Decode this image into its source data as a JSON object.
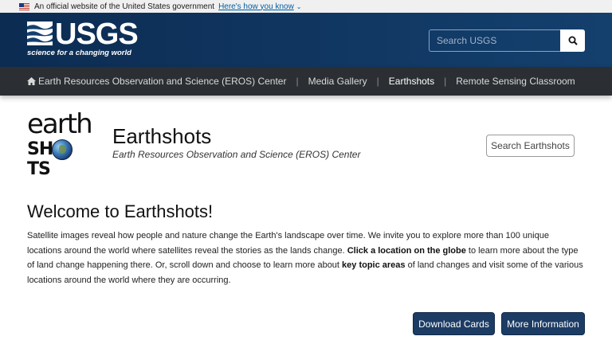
{
  "gov_banner": {
    "text": "An official website of the United States government",
    "link": "Here's how you know"
  },
  "header": {
    "logo_text": "USGS",
    "logo_tagline": "science for a changing world",
    "search_placeholder": "Search USGS"
  },
  "nav": {
    "items": [
      {
        "label": "Earth Resources Observation and Science (EROS) Center"
      },
      {
        "label": "Media Gallery"
      },
      {
        "label": "Earthshots"
      },
      {
        "label": "Remote Sensing Classroom"
      }
    ],
    "active": "Earthshots"
  },
  "title_area": {
    "logo_top": "earth",
    "logo_bottom_left": "SH",
    "logo_bottom_right": "TS",
    "title": "Earthshots",
    "subtitle": "Earth Resources Observation and Science (EROS) Center",
    "search_button": "Search Earthshots"
  },
  "welcome": {
    "heading": "Welcome to Earthshots!",
    "p1": "Satellite images reveal how people and nature change the Earth's landscape over time. We invite you to explore more than 100 unique locations around the world where satellites reveal the stories as the lands change. ",
    "p_bold1": "Click a location on the globe",
    "p2": " to learn more about the type of land change happening there. Or, scroll down and choose to learn more about ",
    "p_bold2": "key topic areas",
    "p3": " of land changes and visit some of the various locations around the world where they are occurring."
  },
  "buttons": {
    "download": "Download Cards",
    "more": "More Information"
  },
  "colors": {
    "header_bg": "#14406e",
    "nav_bg": "#2b2f33",
    "button_bg": "#1c3c64"
  }
}
